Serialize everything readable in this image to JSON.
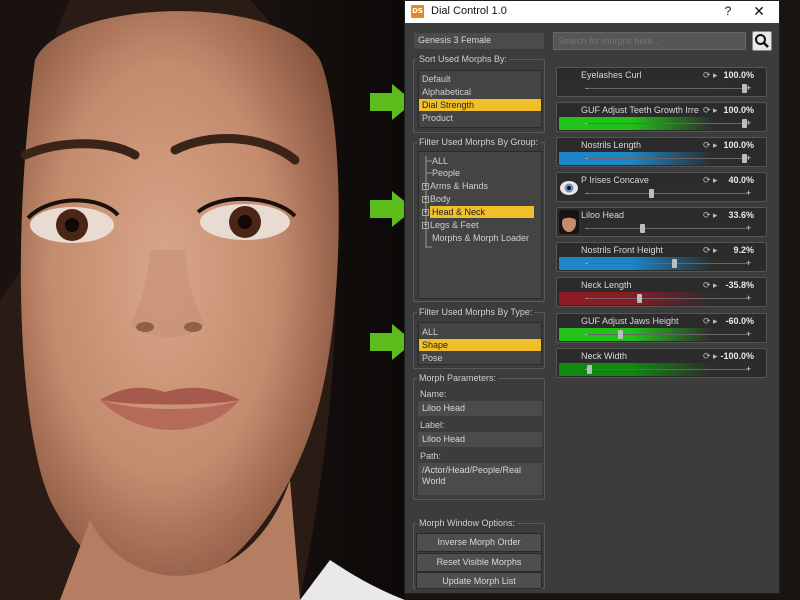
{
  "window": {
    "title": "Dial Control 1.0",
    "help": "?",
    "close": "✕",
    "icon_text": "DS"
  },
  "figure": "Genesis 3 Female",
  "search": {
    "placeholder": "Search for morphs here..."
  },
  "sort": {
    "title": "Sort Used Morphs By:",
    "items": [
      {
        "label": "Default",
        "selected": false
      },
      {
        "label": "Alphabetical",
        "selected": false
      },
      {
        "label": "Dial Strength",
        "selected": true
      },
      {
        "label": "Product",
        "selected": false
      }
    ]
  },
  "group": {
    "title": "Filter Used Morphs By Group:",
    "items": [
      {
        "label": "ALL",
        "expander": ""
      },
      {
        "label": "People",
        "expander": ""
      },
      {
        "label": "Arms & Hands",
        "expander": "+"
      },
      {
        "label": "Body",
        "expander": "+"
      },
      {
        "label": "Head & Neck",
        "expander": "+",
        "selected": true
      },
      {
        "label": "Legs & Feet",
        "expander": "+"
      },
      {
        "label": "Morphs & Morph Loader",
        "expander": ""
      }
    ]
  },
  "type": {
    "title": "Filter Used Morphs By Type:",
    "items": [
      {
        "label": "ALL",
        "selected": false
      },
      {
        "label": "Shape",
        "selected": true
      },
      {
        "label": "Pose",
        "selected": false
      }
    ]
  },
  "params": {
    "title": "Morph Parameters:",
    "name_label": "Name:",
    "name_value": "Liloo Head",
    "label_label": "Label:",
    "label_value": "Liloo Head",
    "path_label": "Path:",
    "path_value": "/Actor/Head/People/Real World"
  },
  "options": {
    "title": "Morph Window Options:",
    "buttons": [
      "Inverse Morph Order",
      "Reset Visible Morphs",
      "Update Morph List"
    ]
  },
  "morphs": [
    {
      "name": "Eyelashes Curl",
      "value": "100.0%",
      "fraction": 1.0,
      "color": "#2d2d2d",
      "thumb": ""
    },
    {
      "name": "GUF Adjust Teeth Growth Irregular",
      "value": "100.0%",
      "fraction": 1.0,
      "color": "#22c21a",
      "thumb": ""
    },
    {
      "name": "Nostrils Length",
      "value": "100.0%",
      "fraction": 1.0,
      "color": "#1d85c8",
      "thumb": ""
    },
    {
      "name": "P Irises Concave",
      "value": "40.0%",
      "fraction": 0.4,
      "color": "#2d2d2d",
      "thumb": "eye"
    },
    {
      "name": "Liloo Head",
      "value": "33.6%",
      "fraction": 0.34,
      "color": "#2d2d2d",
      "thumb": "face"
    },
    {
      "name": "Nostrils Front Height",
      "value": "9.2%",
      "fraction": 0.55,
      "color": "#1d85c8",
      "thumb": ""
    },
    {
      "name": "Neck Length",
      "value": "-35.8%",
      "fraction": 0.32,
      "color": "#8a1a24",
      "thumb": ""
    },
    {
      "name": "GUF Adjust Jaws Height",
      "value": "-60.0%",
      "fraction": 0.2,
      "color": "#22c21a",
      "thumb": ""
    },
    {
      "name": "Neck Width",
      "value": "-100.0%",
      "fraction": 0.0,
      "color": "#118811",
      "thumb": ""
    }
  ],
  "colors": {
    "selection": "#f0bf29",
    "arrow": "#5dbd1c",
    "panel": "#3c3c3c"
  }
}
